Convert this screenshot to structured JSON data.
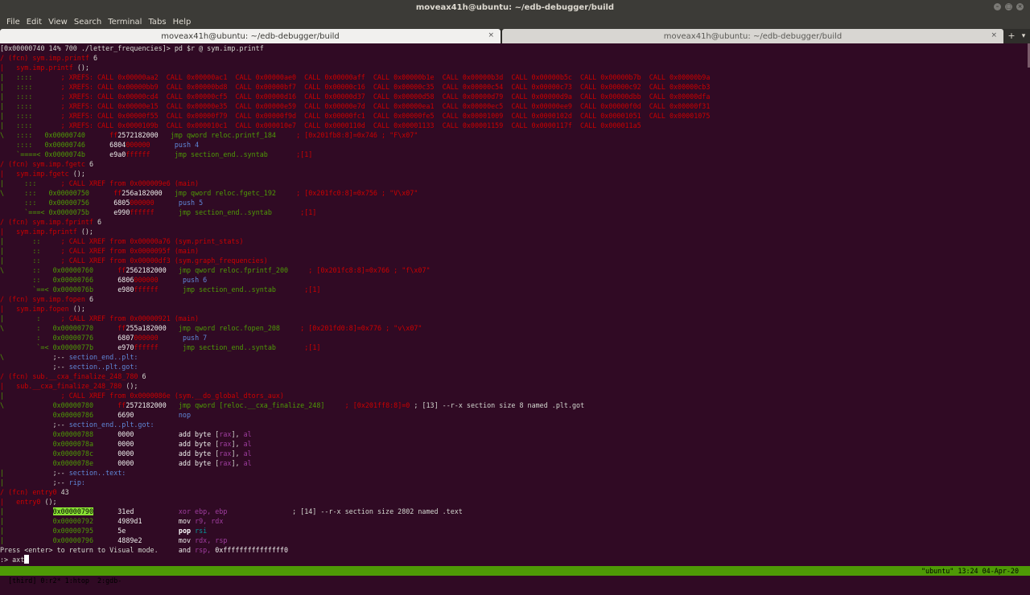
{
  "window": {
    "title": "moveax41h@ubuntu: ~/edb-debugger/build"
  },
  "menu": [
    "File",
    "Edit",
    "View",
    "Search",
    "Terminal",
    "Tabs",
    "Help"
  ],
  "tabs": [
    {
      "label": "moveax41h@ubuntu: ~/edb-debugger/build",
      "close": "×"
    },
    {
      "label": "moveax41h@ubuntu: ~/edb-debugger/build",
      "close": "×"
    }
  ],
  "tabbar": {
    "new_tab": "+",
    "menu": "▾"
  },
  "terminal_lines": [
    [
      [
        "c-p",
        "[0x00000740 14% 700 ./letter_frequencies]> pd $r @ sym.imp.printf"
      ]
    ],
    [
      [
        "c-r",
        "/ (fcn) sym.imp.printf "
      ],
      [
        "c-p",
        "6"
      ]
    ],
    [
      [
        "c-r",
        "|   sym.imp.printf "
      ],
      [
        "c-p",
        "();"
      ]
    ],
    [
      [
        "c-g",
        "|   ::::       "
      ],
      [
        "c-r",
        "; XREFS: CALL 0x00000aa2  CALL 0x00000ac1  CALL 0x00000ae0  CALL 0x00000aff  CALL 0x00000b1e  CALL 0x00000b3d  CALL 0x00000b5c  CALL 0x00000b7b  CALL 0x00000b9a"
      ]
    ],
    [
      [
        "c-g",
        "|   ::::       "
      ],
      [
        "c-r",
        "; XREFS: CALL 0x00000bb9  CALL 0x00000bd8  CALL 0x00000bf7  CALL 0x00000c16  CALL 0x00000c35  CALL 0x00000c54  CALL 0x00000c73  CALL 0x00000c92  CALL 0x00000cb3"
      ]
    ],
    [
      [
        "c-g",
        "|   ::::       "
      ],
      [
        "c-r",
        "; XREFS: CALL 0x00000cd4  CALL 0x00000cf5  CALL 0x00000d16  CALL 0x00000d37  CALL 0x00000d58  CALL 0x00000d79  CALL 0x00000d9a  CALL 0x00000dbb  CALL 0x00000dfa"
      ]
    ],
    [
      [
        "c-g",
        "|   ::::       "
      ],
      [
        "c-r",
        "; XREFS: CALL 0x00000e15  CALL 0x00000e35  CALL 0x00000e59  CALL 0x00000e7d  CALL 0x00000ea1  CALL 0x00000ec5  CALL 0x00000ee9  CALL 0x00000f0d  CALL 0x00000f31"
      ]
    ],
    [
      [
        "c-g",
        "|   ::::       "
      ],
      [
        "c-r",
        "; XREFS: CALL 0x00000f55  CALL 0x00000f79  CALL 0x00000f9d  CALL 0x00000fc1  CALL 0x00000fe5  CALL 0x00001009  CALL 0x0000102d  CALL 0x00001051  CALL 0x00001075"
      ]
    ],
    [
      [
        "c-g",
        "|   ::::       "
      ],
      [
        "c-r",
        "; XREFS: CALL 0x0000109b  CALL 0x000010c1  CALL 0x000010e7  CALL 0x0000110d  CALL 0x00001133  CALL 0x00001159  CALL 0x0000117f  CALL 0x000011a5"
      ]
    ],
    [
      [
        "c-g",
        "\\   ::::   "
      ],
      [
        "c-g",
        "0x00000740      "
      ],
      [
        "c-r",
        "ff"
      ],
      [
        "c-w",
        "2572182000"
      ],
      [
        "c-p",
        "   "
      ],
      [
        "c-g",
        "jmp qword reloc.printf_184"
      ],
      [
        "c-r",
        "     ; [0x201fb8:8]=0x746 ; \"F\\x07\""
      ]
    ],
    [
      [
        "c-g",
        "    ::::   "
      ],
      [
        "c-g",
        "0x00000746      "
      ],
      [
        "c-w",
        "6804"
      ],
      [
        "c-r",
        "000000"
      ],
      [
        "c-p",
        "      "
      ],
      [
        "c-b",
        "push 4"
      ]
    ],
    [
      [
        "c-g",
        "    `====< "
      ],
      [
        "c-g",
        "0x0000074b      "
      ],
      [
        "c-w",
        "e9a0"
      ],
      [
        "c-r",
        "ffffff"
      ],
      [
        "c-p",
        "      "
      ],
      [
        "c-g",
        "jmp section_end..syntab"
      ],
      [
        "c-r",
        "       ;[1]"
      ]
    ],
    [
      [
        "c-r",
        "/ (fcn) sym.imp.fgetc "
      ],
      [
        "c-p",
        "6"
      ]
    ],
    [
      [
        "c-r",
        "|   sym.imp.fgetc "
      ],
      [
        "c-p",
        "();"
      ]
    ],
    [
      [
        "c-g",
        "|     :::      "
      ],
      [
        "c-r",
        "; CALL XREF from 0x000009e6 (main)"
      ]
    ],
    [
      [
        "c-g",
        "\\     :::   "
      ],
      [
        "c-g",
        "0x00000750      "
      ],
      [
        "c-r",
        "ff"
      ],
      [
        "c-w",
        "256a182000"
      ],
      [
        "c-p",
        "   "
      ],
      [
        "c-g",
        "jmp qword reloc.fgetc_192"
      ],
      [
        "c-r",
        "     ; [0x201fc0:8]=0x756 ; \"V\\x07\""
      ]
    ],
    [
      [
        "c-g",
        "      :::   "
      ],
      [
        "c-g",
        "0x00000756      "
      ],
      [
        "c-w",
        "6805"
      ],
      [
        "c-r",
        "000000"
      ],
      [
        "c-p",
        "      "
      ],
      [
        "c-b",
        "push 5"
      ]
    ],
    [
      [
        "c-g",
        "      `===< "
      ],
      [
        "c-g",
        "0x0000075b      "
      ],
      [
        "c-w",
        "e990"
      ],
      [
        "c-r",
        "ffffff"
      ],
      [
        "c-p",
        "      "
      ],
      [
        "c-g",
        "jmp section_end..syntab"
      ],
      [
        "c-r",
        "       ;[1]"
      ]
    ],
    [
      [
        "c-r",
        "/ (fcn) sym.imp.fprintf "
      ],
      [
        "c-p",
        "6"
      ]
    ],
    [
      [
        "c-r",
        "|   sym.imp.fprintf "
      ],
      [
        "c-p",
        "();"
      ]
    ],
    [
      [
        "c-g",
        "|       ::     "
      ],
      [
        "c-r",
        "; CALL XREF from 0x00000a76 (sym.print_stats)"
      ]
    ],
    [
      [
        "c-g",
        "|       ::     "
      ],
      [
        "c-r",
        "; CALL XREF from 0x0000095f (main)"
      ]
    ],
    [
      [
        "c-g",
        "|       ::     "
      ],
      [
        "c-r",
        "; CALL XREF from 0x00000df3 (sym.graph_frequencies)"
      ]
    ],
    [
      [
        "c-g",
        "\\       ::   "
      ],
      [
        "c-g",
        "0x00000760      "
      ],
      [
        "c-r",
        "ff"
      ],
      [
        "c-w",
        "2562182000"
      ],
      [
        "c-p",
        "   "
      ],
      [
        "c-g",
        "jmp qword reloc.fprintf_200"
      ],
      [
        "c-r",
        "     ; [0x201fc8:8]=0x766 ; \"f\\x07\""
      ]
    ],
    [
      [
        "c-g",
        "        ::   "
      ],
      [
        "c-g",
        "0x00000766      "
      ],
      [
        "c-w",
        "6806"
      ],
      [
        "c-r",
        "000000"
      ],
      [
        "c-p",
        "      "
      ],
      [
        "c-b",
        "push 6"
      ]
    ],
    [
      [
        "c-g",
        "        `==< "
      ],
      [
        "c-g",
        "0x0000076b      "
      ],
      [
        "c-w",
        "e980"
      ],
      [
        "c-r",
        "ffffff"
      ],
      [
        "c-p",
        "      "
      ],
      [
        "c-g",
        "jmp section_end..syntab"
      ],
      [
        "c-r",
        "       ;[1]"
      ]
    ],
    [
      [
        "c-r",
        "/ (fcn) sym.imp.fopen "
      ],
      [
        "c-p",
        "6"
      ]
    ],
    [
      [
        "c-r",
        "|   sym.imp.fopen "
      ],
      [
        "c-p",
        "();"
      ]
    ],
    [
      [
        "c-g",
        "|        :     "
      ],
      [
        "c-r",
        "; CALL XREF from 0x00000921 (main)"
      ]
    ],
    [
      [
        "c-g",
        "\\        :   "
      ],
      [
        "c-g",
        "0x00000770      "
      ],
      [
        "c-r",
        "ff"
      ],
      [
        "c-w",
        "255a182000"
      ],
      [
        "c-p",
        "   "
      ],
      [
        "c-g",
        "jmp qword reloc.fopen_208"
      ],
      [
        "c-r",
        "     ; [0x201fd0:8]=0x776 ; \"v\\x07\""
      ]
    ],
    [
      [
        "c-g",
        "         :   "
      ],
      [
        "c-g",
        "0x00000776      "
      ],
      [
        "c-w",
        "6807"
      ],
      [
        "c-r",
        "000000"
      ],
      [
        "c-p",
        "      "
      ],
      [
        "c-b",
        "push 7"
      ]
    ],
    [
      [
        "c-g",
        "         `=< "
      ],
      [
        "c-g",
        "0x0000077b      "
      ],
      [
        "c-w",
        "e970"
      ],
      [
        "c-r",
        "ffffff"
      ],
      [
        "c-p",
        "      "
      ],
      [
        "c-g",
        "jmp section_end..syntab"
      ],
      [
        "c-r",
        "       ;[1]"
      ]
    ],
    [
      [
        "c-g",
        "\\            "
      ],
      [
        "c-p",
        ";-- "
      ],
      [
        "c-b",
        "section_end..plt:"
      ]
    ],
    [
      [
        "c-p",
        "             ;-- "
      ],
      [
        "c-b",
        "section..plt.got:"
      ]
    ],
    [
      [
        "c-r",
        "/ (fcn) sub.__cxa_finalize_248_780 "
      ],
      [
        "c-p",
        "6"
      ]
    ],
    [
      [
        "c-r",
        "|   sub.__cxa_finalize_248_780 "
      ],
      [
        "c-p",
        "();"
      ]
    ],
    [
      [
        "c-g",
        "|              "
      ],
      [
        "c-r",
        "; CALL XREF from 0x0000086e (sym.__do_global_dtors_aux)"
      ]
    ],
    [
      [
        "c-g",
        "\\            "
      ],
      [
        "c-g",
        "0x00000780      "
      ],
      [
        "c-r",
        "ff"
      ],
      [
        "c-w",
        "2572182000"
      ],
      [
        "c-p",
        "   "
      ],
      [
        "c-g",
        "jmp qword [reloc.__cxa_finalize_248]"
      ],
      [
        "c-r",
        "     ; [0x201ff8:8]=0"
      ],
      [
        "c-p",
        " ; [13] --r-x section size 8 named .plt.got"
      ]
    ],
    [
      [
        "c-p",
        "             "
      ],
      [
        "c-g",
        "0x00000786      "
      ],
      [
        "c-w",
        "6690"
      ],
      [
        "c-p",
        "           "
      ],
      [
        "c-b",
        "nop"
      ]
    ],
    [
      [
        "c-p",
        "             ;-- "
      ],
      [
        "c-b",
        "section_end..plt.got:"
      ]
    ],
    [
      [
        "c-p",
        "             "
      ],
      [
        "c-g",
        "0x00000788      "
      ],
      [
        "c-w",
        "0000"
      ],
      [
        "c-p",
        "           "
      ],
      [
        "c-w",
        "add byte "
      ],
      [
        "c-p",
        "["
      ],
      [
        "c-m",
        "rax"
      ],
      [
        "c-p",
        "], "
      ],
      [
        "c-m",
        "al"
      ]
    ],
    [
      [
        "c-p",
        "             "
      ],
      [
        "c-g",
        "0x0000078a      "
      ],
      [
        "c-w",
        "0000"
      ],
      [
        "c-p",
        "           "
      ],
      [
        "c-w",
        "add byte "
      ],
      [
        "c-p",
        "["
      ],
      [
        "c-m",
        "rax"
      ],
      [
        "c-p",
        "], "
      ],
      [
        "c-m",
        "al"
      ]
    ],
    [
      [
        "c-p",
        "             "
      ],
      [
        "c-g",
        "0x0000078c      "
      ],
      [
        "c-w",
        "0000"
      ],
      [
        "c-p",
        "           "
      ],
      [
        "c-w",
        "add byte "
      ],
      [
        "c-p",
        "["
      ],
      [
        "c-m",
        "rax"
      ],
      [
        "c-p",
        "], "
      ],
      [
        "c-m",
        "al"
      ]
    ],
    [
      [
        "c-p",
        "             "
      ],
      [
        "c-g",
        "0x0000078e      "
      ],
      [
        "c-w",
        "0000"
      ],
      [
        "c-p",
        "           "
      ],
      [
        "c-w",
        "add byte "
      ],
      [
        "c-p",
        "["
      ],
      [
        "c-m",
        "rax"
      ],
      [
        "c-p",
        "], "
      ],
      [
        "c-m",
        "al"
      ]
    ],
    [
      [
        "c-g",
        "|            "
      ],
      [
        "c-p",
        ";-- "
      ],
      [
        "c-b",
        "section..text:"
      ]
    ],
    [
      [
        "c-g",
        "|            "
      ],
      [
        "c-p",
        ";-- "
      ],
      [
        "c-b",
        "rip:"
      ]
    ],
    [
      [
        "c-r",
        "/ (fcn) entry0 "
      ],
      [
        "c-p",
        "43"
      ]
    ],
    [
      [
        "c-r",
        "|   entry0 "
      ],
      [
        "c-p",
        "();"
      ]
    ],
    [
      [
        "c-g",
        "|            "
      ],
      [
        "hl",
        "0x00000790"
      ],
      [
        "c-p",
        "      "
      ],
      [
        "c-w",
        "31ed"
      ],
      [
        "c-p",
        "           "
      ],
      [
        "c-m",
        "xor ebp, ebp"
      ],
      [
        "c-p",
        "                ; [14] --r-x section size 2802 named .text"
      ]
    ],
    [
      [
        "c-g",
        "|            "
      ],
      [
        "c-g",
        "0x00000792      "
      ],
      [
        "c-w",
        "4989d1"
      ],
      [
        "c-p",
        "         "
      ],
      [
        "c-w",
        "mov "
      ],
      [
        "c-m",
        "r9, rdx"
      ]
    ],
    [
      [
        "c-g",
        "|            "
      ],
      [
        "c-g",
        "0x00000795      "
      ],
      [
        "c-w",
        "5e"
      ],
      [
        "c-p",
        "             "
      ],
      [
        "c-wb",
        "pop "
      ],
      [
        "c-c",
        "rsi"
      ]
    ],
    [
      [
        "c-g",
        "|            "
      ],
      [
        "c-g",
        "0x00000796      "
      ],
      [
        "c-w",
        "4889e2"
      ],
      [
        "c-p",
        "         "
      ],
      [
        "c-w",
        "mov "
      ],
      [
        "c-m",
        "rdx, rsp"
      ]
    ],
    [
      [
        "c-p",
        "Press <enter> to return to Visual mode.     "
      ],
      [
        "c-w",
        "and "
      ],
      [
        "c-m",
        "rsp, "
      ],
      [
        "c-w",
        "0xfffffffffffffff0"
      ]
    ]
  ],
  "prompt": {
    "text": ":> axt"
  },
  "statusbar": {
    "left": "[third] 0:r2* 1:htop  2:gdb-",
    "right": "\"ubuntu\" 13:24 04-Apr-20"
  }
}
